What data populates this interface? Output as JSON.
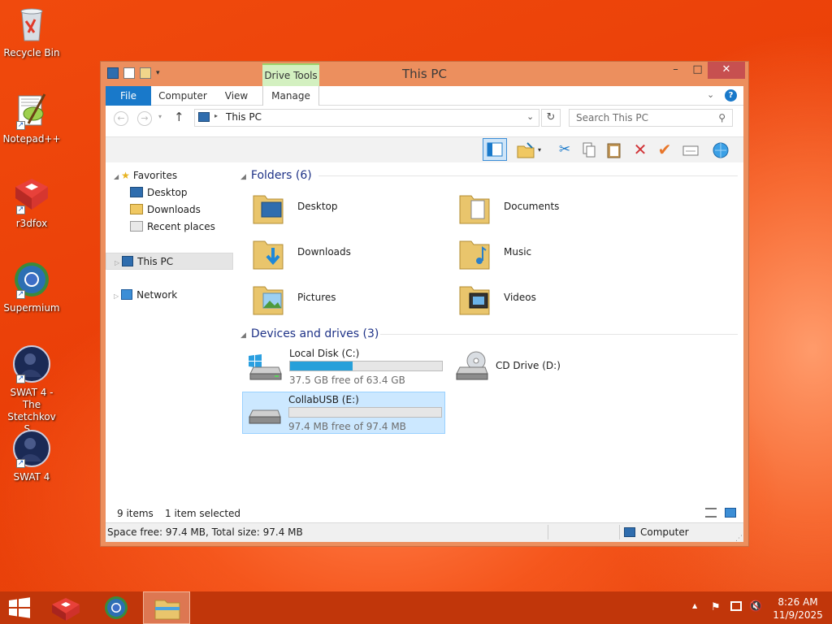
{
  "desktop": {
    "icons": [
      {
        "label": "Recycle Bin"
      },
      {
        "label": "Notepad++"
      },
      {
        "label": "r3dfox"
      },
      {
        "label": "Supermium"
      },
      {
        "label": "SWAT 4 - The Stetchkov S..."
      },
      {
        "label": "SWAT 4"
      }
    ]
  },
  "window": {
    "title": "This PC",
    "context_tab": "Drive Tools",
    "controls": {
      "minimize": "–",
      "maximize": "□",
      "close": "✕"
    },
    "ribbon_tabs": [
      "File",
      "Computer",
      "View",
      "Manage"
    ],
    "address": "This PC",
    "search_placeholder": "Search This PC",
    "nav": {
      "favorites": "Favorites",
      "favorites_items": [
        "Desktop",
        "Downloads",
        "Recent places"
      ],
      "this_pc": "This PC",
      "network": "Network"
    },
    "folders_header": "Folders (6)",
    "folders": [
      "Desktop",
      "Documents",
      "Downloads",
      "Music",
      "Pictures",
      "Videos"
    ],
    "devices_header": "Devices and drives (3)",
    "drives": [
      {
        "name": "Local Disk (C:)",
        "free_text": "37.5 GB free of 63.4 GB",
        "used_fraction": 0.41
      },
      {
        "name": "CD Drive (D:)"
      },
      {
        "name": "CollabUSB (E:)",
        "free_text": "97.4 MB free of 97.4 MB",
        "used_fraction": 0.0
      }
    ],
    "status": {
      "items": "9 items",
      "selected": "1 item selected"
    },
    "details": {
      "space": "Space free: 97.4 MB, Total size: 97.4 MB",
      "location": "Computer"
    }
  },
  "taskbar": {
    "clock_time": "8:26 AM",
    "clock_date": "11/9/2025",
    "tray_chevron": "▲"
  },
  "colors": {
    "accent": "#1979ca",
    "window_frame": "#ec8f5e",
    "taskbar": "#c1360a",
    "drive_bar": "#26a0da"
  }
}
